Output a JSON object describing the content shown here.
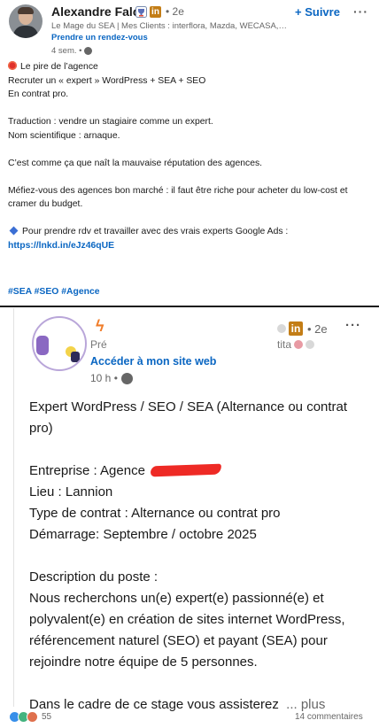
{
  "post": {
    "author_name": "Alexandre Falck",
    "degree": "• 2e",
    "li_badge": "in",
    "subtitle": "Le Mage du SEA | Mes Clients : interflora, Mazda, WECASA, W...",
    "cta": "Prendre un rendez-vous",
    "time": "4 sem. •",
    "follow_label": "+ Suivre",
    "menu_label": "···",
    "lines": [
      "Le pire de l’agence",
      "Recruter un « expert » WordPress + SEA + SEO",
      "En contrat pro.",
      "",
      "Traduction : vendre un stagiaire comme un expert.",
      "Nom scientifique : arnaque.",
      "",
      "C’est comme ça que naît la mauvaise réputation des agences.",
      "",
      "Méfiez-vous des agences bon marché : il faut être riche pour acheter du low-cost et cramer du budget.",
      "",
      "Pour prendre rdv et travailler avec des vrais experts Google Ads :"
    ],
    "link": "https://lnkd.in/eJz46qUE",
    "hashtags": "#SEA #SEO #Agence",
    "icons": {
      "first_line": "red-circle-emoji",
      "cta_line": "blue-diamond-emoji",
      "badge": "red-trophy-badge"
    }
  },
  "shared": {
    "bolt": "ϟ",
    "author_prefix": "Pré",
    "author_suffix": "tita",
    "degree": "• 2e",
    "li_badge": "in",
    "cta": "Accéder à mon site web",
    "time": "10 h •",
    "menu_label": "···",
    "text_lines": [
      "Expert WordPress / SEO / SEA (Alternance ou contrat pro)",
      "",
      "Entreprise : Agence",
      "Lieu : Lannion",
      "Type de contrat : Alternance ou contrat pro",
      "Démarrage: Septembre / octobre 2025",
      "",
      "Description du poste :",
      "Nous recherchons un(e) expert(e) passionné(e) et polyvalent(e) en création de sites internet WordPress, référencement naturel (SEO) et payant (SEA) pour rejoindre notre équipe de 5 personnes.",
      "",
      "Dans le cadre de ce stage vous assisterez"
    ],
    "see_more": "... plus"
  },
  "footer": {
    "reactions_count": "55",
    "reaction_icons": [
      "like-icon",
      "celebrate-icon",
      "love-icon"
    ],
    "comments": "14 commentaires"
  }
}
